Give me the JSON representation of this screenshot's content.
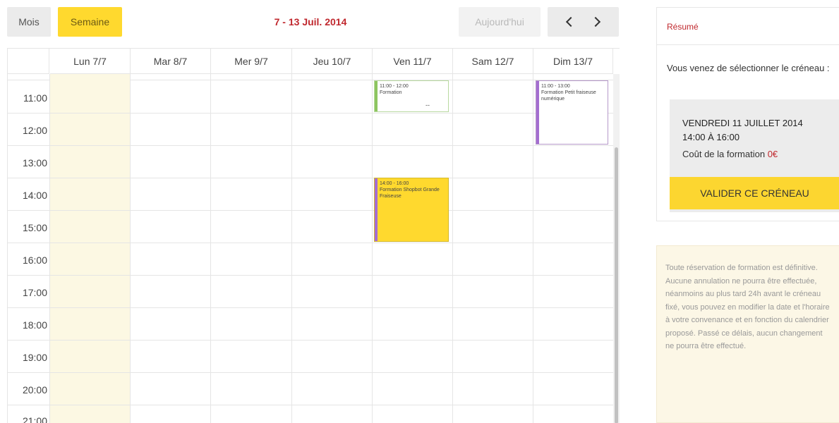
{
  "toolbar": {
    "month_label": "Mois",
    "week_label": "Semaine",
    "range_title": "7 - 13 Juil. 2014",
    "today_label": "Aujourd'hui"
  },
  "calendar": {
    "days": [
      "Lun 7/7",
      "Mar 8/7",
      "Mer 9/7",
      "Jeu 10/7",
      "Ven 11/7",
      "Sam 12/7",
      "Dim 13/7"
    ],
    "hours": [
      "11:00",
      "12:00",
      "13:00",
      "14:00",
      "15:00",
      "16:00",
      "17:00",
      "18:00",
      "19:00",
      "20:00",
      "21:00"
    ],
    "events": [
      {
        "time": "11:00 - 12:00",
        "title": "Formation",
        "extra": "--"
      },
      {
        "time": "11:00 - 13:00",
        "title": "Formation Petit fraiseuse numérique"
      },
      {
        "time": "14:00 - 16:00",
        "title": "Formation Shopbot Grande Fraiseuse"
      }
    ]
  },
  "summary": {
    "title": "Résumé",
    "intro": "Vous venez de sélectionner le créneau :",
    "slot_date": "VENDREDI 11 JUILLET 2014",
    "slot_time": "14:00 À 16:00",
    "cost_label": "Coût de la formation",
    "cost_value": "0€",
    "validate_label": "VALIDER CE CRÉNEAU"
  },
  "notice": {
    "text": "Toute réservation de formation est définitive. Aucune annulation ne pourra être effectuée, néanmoins au plus tard 24h avant le créneau fixé, vous pouvez en modifier la date et l'horaire à votre convenance et en fonction du calendrier proposé. Passé ce délais, aucun changement ne pourra être effectué."
  },
  "colors": {
    "accent_yellow": "#ffd92e",
    "accent_red": "#c0282e",
    "today_bg": "#fcf8e3",
    "event_green": "#8dc55f",
    "event_purple": "#a46ed0"
  }
}
